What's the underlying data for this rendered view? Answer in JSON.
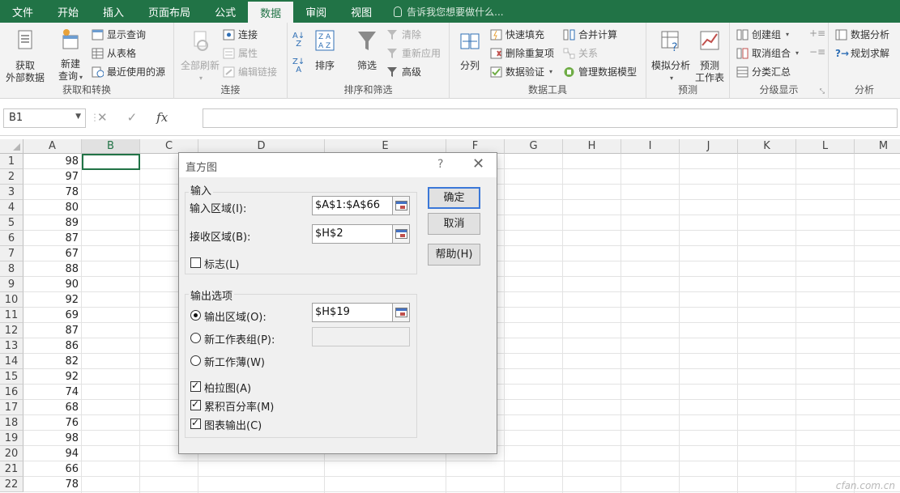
{
  "tabs": [
    "文件",
    "开始",
    "插入",
    "页面布局",
    "公式",
    "数据",
    "审阅",
    "视图"
  ],
  "active_tab": "数据",
  "tellme": "告诉我您想要做什么...",
  "ribbon": {
    "get_transform": {
      "label": "获取和转换",
      "get_external": [
        "获取",
        "外部数据"
      ],
      "new_query": [
        "新建",
        "查询"
      ],
      "show_query": "显示查询",
      "from_table": "从表格",
      "recent_sources": "最近使用的源"
    },
    "connections": {
      "label": "连接",
      "refresh_all": "全部刷新",
      "connections": "连接",
      "properties": "属性",
      "edit_links": "编辑链接"
    },
    "sort_filter": {
      "label": "排序和筛选",
      "sort": "排序",
      "filter": "筛选",
      "clear": "清除",
      "reapply": "重新应用",
      "advanced": "高级"
    },
    "data_tools": {
      "label": "数据工具",
      "text_to_columns": "分列",
      "flash_fill": "快速填充",
      "remove_duplicates": "删除重复项",
      "data_validation": "数据验证",
      "consolidate": "合并计算",
      "relationships": "关系",
      "manage_model": "管理数据模型"
    },
    "forecast": {
      "label": "预测",
      "what_if": "模拟分析",
      "forecast_sheet": [
        "预测",
        "工作表"
      ]
    },
    "outline": {
      "label": "分级显示",
      "group": "创建组",
      "ungroup": "取消组合",
      "subtotal": "分类汇总"
    },
    "analysis": {
      "label": "分析",
      "data_analysis": "数据分析",
      "solver": "规划求解"
    }
  },
  "formula_bar": {
    "name_box": "B1",
    "fx": "fx",
    "cancel": "✕",
    "enter": "✓",
    "value": ""
  },
  "columns": [
    "A",
    "B",
    "C",
    "D",
    "E",
    "F",
    "G",
    "H",
    "I",
    "J",
    "K",
    "L",
    "M"
  ],
  "rows": [
    "1",
    "2",
    "3",
    "4",
    "5",
    "6",
    "7",
    "8",
    "9",
    "10",
    "11",
    "12",
    "13",
    "14",
    "15",
    "16",
    "17",
    "18",
    "19",
    "20",
    "21",
    "22"
  ],
  "col_a_values": [
    "98",
    "97",
    "78",
    "80",
    "89",
    "87",
    "67",
    "88",
    "90",
    "92",
    "69",
    "87",
    "86",
    "82",
    "92",
    "74",
    "68",
    "76",
    "98",
    "94",
    "66",
    "78"
  ],
  "dialog": {
    "title": "直方图",
    "help": "?",
    "close": "✕",
    "input_section": "输入",
    "input_range_label": "输入区域(I):",
    "input_range_value": "$A$1:$A$66",
    "bin_range_label": "接收区域(B):",
    "bin_range_value": "$H$2",
    "labels_label": "标志(L)",
    "output_section": "输出选项",
    "output_range_label": "输出区域(O):",
    "output_range_value": "$H$19",
    "new_ws_label": "新工作表组(P):",
    "new_wb_label": "新工作薄(W)",
    "pareto_label": "柏拉图(A)",
    "cumulative_label": "累积百分率(M)",
    "chart_label": "图表输出(C)",
    "ok": "确定",
    "cancel": "取消",
    "help_btn": "帮助(H)"
  },
  "watermark": "cfan.com.cn"
}
